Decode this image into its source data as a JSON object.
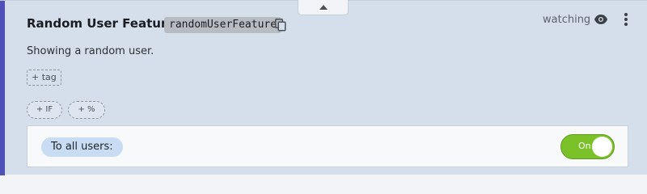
{
  "feature": {
    "title": "Random User Feature",
    "key": "randomUserFeature",
    "description": "Showing a random user.",
    "watch_status": "watching"
  },
  "tags": {
    "add_label": "+ tag"
  },
  "conditions": {
    "add_if_label": "+ IF",
    "add_percent_label": "+ %"
  },
  "rule": {
    "target_label": "To all users:",
    "toggle_label": "On",
    "toggle_on": true
  },
  "icons": {
    "collapse": "chevron-up-icon",
    "copy": "copy-icon",
    "watch": "eye-icon",
    "menu": "more-vertical-icon"
  },
  "colors": {
    "accent": "#4f51b8",
    "card_bg": "#d5dfec",
    "toggle_on": "#7bc22a",
    "target_chip": "#c8dcf4"
  }
}
